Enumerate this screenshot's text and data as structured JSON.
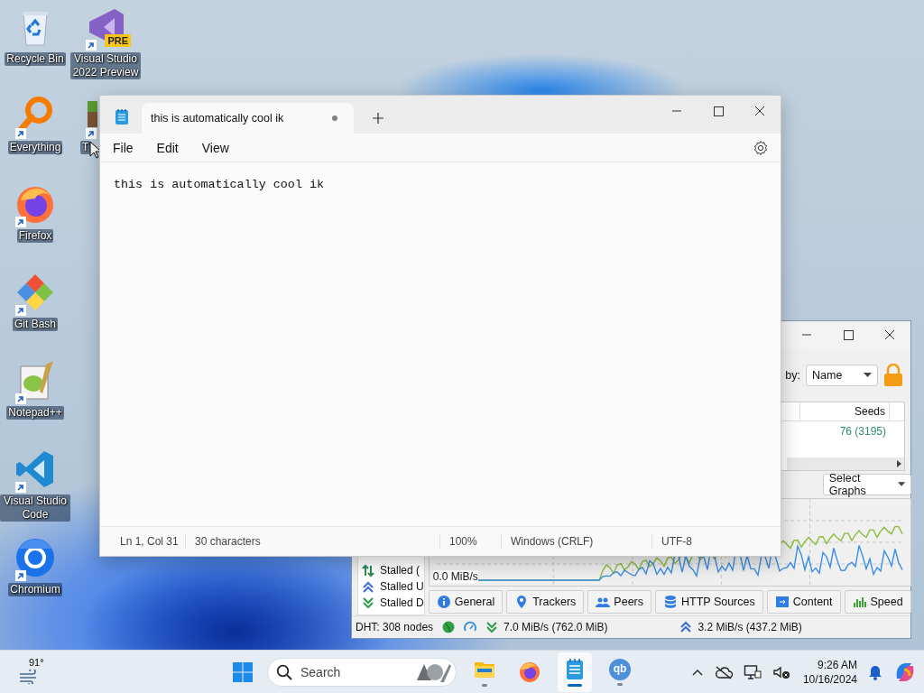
{
  "desktop_icons": [
    {
      "label": "Recycle Bin",
      "kind": "recycle-bin",
      "shortcut": false,
      "clipped": false
    },
    {
      "label": "Everything",
      "kind": "everything",
      "shortcut": true,
      "clipped": false
    },
    {
      "label": "Firefox",
      "kind": "firefox",
      "shortcut": true,
      "clipped": false
    },
    {
      "label": "Git Bash",
      "kind": "git-bash",
      "shortcut": true,
      "clipped": false
    },
    {
      "label": "Notepad++",
      "kind": "notepadpp",
      "shortcut": true,
      "clipped": false
    },
    {
      "label": "Visual Studio Code",
      "kind": "vscode",
      "shortcut": true,
      "clipped": false
    },
    {
      "label": "Chromium",
      "kind": "chromium",
      "shortcut": true,
      "clipped": false
    },
    {
      "label": "Visual Studio 2022 Preview",
      "kind": "visual-studio",
      "shortcut": true,
      "clipped": false,
      "badge": "PRE"
    },
    {
      "label": "T",
      "kind": "block",
      "shortcut": true,
      "clipped": true
    }
  ],
  "notepad": {
    "tab": {
      "title": "this is automatically cool ik",
      "selected": true,
      "modified": true
    },
    "menu": [
      "File",
      "Edit",
      "View"
    ],
    "text": "this is automatically cool ik",
    "status_bar": [
      "Ln 1, Col 31",
      "30 characters",
      "100%",
      "Windows (CRLF)",
      "UTF-8"
    ]
  },
  "qbittorrent": {
    "sort_label": "by:",
    "sort_value": "Name",
    "table": {
      "columns": [
        "Seeds"
      ],
      "rows": [
        [
          "76 (3195)"
        ]
      ]
    },
    "graph_select": "Select Graphs",
    "graph_labels": [
      "0.0 MiB/s"
    ],
    "status_filters": [
      {
        "label": "Stalled (",
        "kind": "updown"
      },
      {
        "label": "Stalled U",
        "kind": "up"
      },
      {
        "label": "Stalled D",
        "kind": "down"
      }
    ],
    "tabs": [
      {
        "label": "General",
        "kind": "info"
      },
      {
        "label": "Trackers",
        "kind": "pin"
      },
      {
        "label": "Peers",
        "kind": "people"
      },
      {
        "label": "HTTP Sources",
        "kind": "database"
      },
      {
        "label": "Content",
        "kind": "folder"
      },
      {
        "label": "Speed",
        "kind": "bars"
      }
    ],
    "status_bar": {
      "dht": "DHT: 308 nodes",
      "download": "7.0 MiB/s (762.0 MiB)",
      "upload": "3.2 MiB/s (437.2 MiB)"
    }
  },
  "taskbar": {
    "weather": "91°",
    "search": {
      "placeholder": "Search"
    },
    "apps": [
      {
        "kind": "file-explorer",
        "running": true,
        "active": false
      },
      {
        "kind": "firefox",
        "running": false,
        "active": false
      },
      {
        "kind": "notepad",
        "running": true,
        "active": true
      },
      {
        "kind": "qbittorrent",
        "running": true,
        "active": false,
        "logo_text": "qb"
      }
    ],
    "time": "9:26 AM",
    "date": "10/16/2024"
  }
}
